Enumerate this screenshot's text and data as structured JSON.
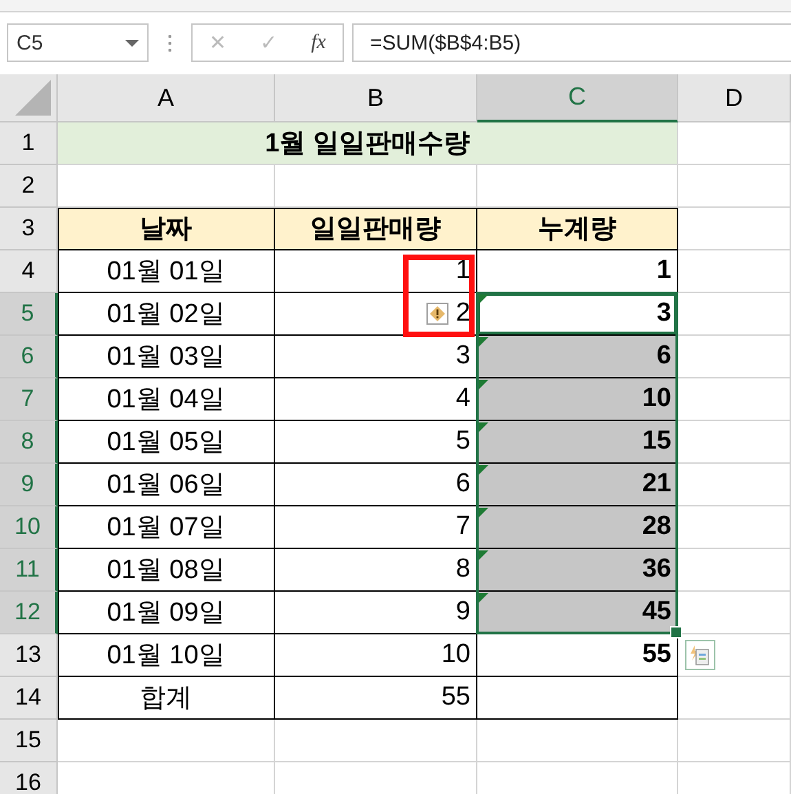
{
  "formula_bar": {
    "name_box": "C5",
    "cancel_button": {
      "label": "✕",
      "disabled": true
    },
    "enter_button": {
      "label": "✓",
      "disabled": true
    },
    "function_button": "fx",
    "formula": "=SUM($B$4:B5)"
  },
  "columns": [
    {
      "label": "A",
      "selected": false
    },
    {
      "label": "B",
      "selected": false
    },
    {
      "label": "C",
      "selected": true
    },
    {
      "label": "D",
      "selected": false
    }
  ],
  "rows": [
    {
      "num": "1",
      "selected": false,
      "cells": [
        {
          "kind": "title",
          "text": "1월 일일판매수량",
          "selected": false,
          "active": false,
          "flagged": false
        }
      ]
    },
    {
      "num": "2",
      "selected": false
    },
    {
      "num": "3",
      "selected": false,
      "cells": [
        {
          "kind": "header",
          "text": "날짜",
          "selected": false,
          "active": false,
          "flagged": false
        },
        {
          "kind": "header",
          "text": "일일판매량",
          "selected": false,
          "active": false,
          "flagged": false
        },
        {
          "kind": "header",
          "text": "누계량",
          "selected": false,
          "active": false,
          "flagged": false
        }
      ]
    },
    {
      "num": "4",
      "selected": false,
      "cells": [
        {
          "kind": "label",
          "text": "01월 01일",
          "selected": false,
          "active": false,
          "flagged": false
        },
        {
          "kind": "number",
          "text": "1",
          "selected": false,
          "active": false,
          "flagged": false
        },
        {
          "kind": "bold-number",
          "text": "1",
          "selected": false,
          "active": false,
          "flagged": false
        }
      ]
    },
    {
      "num": "5",
      "selected": true,
      "cells": [
        {
          "kind": "label",
          "text": "01월 02일",
          "selected": false,
          "active": false,
          "flagged": false
        },
        {
          "kind": "number",
          "text": "2",
          "selected": false,
          "active": false,
          "flagged": false,
          "badges": [
            {
              "kind": "error-check"
            }
          ]
        },
        {
          "kind": "bold-number",
          "text": "3",
          "selected": true,
          "active": true,
          "flagged": true
        }
      ]
    },
    {
      "num": "6",
      "selected": true,
      "cells": [
        {
          "kind": "label",
          "text": "01월 03일",
          "selected": false,
          "active": false,
          "flagged": false
        },
        {
          "kind": "number",
          "text": "3",
          "selected": false,
          "active": false,
          "flagged": false
        },
        {
          "kind": "bold-number",
          "text": "6",
          "selected": true,
          "active": false,
          "flagged": true
        }
      ]
    },
    {
      "num": "7",
      "selected": true,
      "cells": [
        {
          "kind": "label",
          "text": "01월 04일",
          "selected": false,
          "active": false,
          "flagged": false
        },
        {
          "kind": "number",
          "text": "4",
          "selected": false,
          "active": false,
          "flagged": false
        },
        {
          "kind": "bold-number",
          "text": "10",
          "selected": true,
          "active": false,
          "flagged": true
        }
      ]
    },
    {
      "num": "8",
      "selected": true,
      "cells": [
        {
          "kind": "label",
          "text": "01월 05일",
          "selected": false,
          "active": false,
          "flagged": false
        },
        {
          "kind": "number",
          "text": "5",
          "selected": false,
          "active": false,
          "flagged": false
        },
        {
          "kind": "bold-number",
          "text": "15",
          "selected": true,
          "active": false,
          "flagged": true
        }
      ]
    },
    {
      "num": "9",
      "selected": true,
      "cells": [
        {
          "kind": "label",
          "text": "01월 06일",
          "selected": false,
          "active": false,
          "flagged": false
        },
        {
          "kind": "number",
          "text": "6",
          "selected": false,
          "active": false,
          "flagged": false
        },
        {
          "kind": "bold-number",
          "text": "21",
          "selected": true,
          "active": false,
          "flagged": true
        }
      ]
    },
    {
      "num": "10",
      "selected": true,
      "cells": [
        {
          "kind": "label",
          "text": "01월 07일",
          "selected": false,
          "active": false,
          "flagged": false
        },
        {
          "kind": "number",
          "text": "7",
          "selected": false,
          "active": false,
          "flagged": false
        },
        {
          "kind": "bold-number",
          "text": "28",
          "selected": true,
          "active": false,
          "flagged": true
        }
      ]
    },
    {
      "num": "11",
      "selected": true,
      "cells": [
        {
          "kind": "label",
          "text": "01월 08일",
          "selected": false,
          "active": false,
          "flagged": false
        },
        {
          "kind": "number",
          "text": "8",
          "selected": false,
          "active": false,
          "flagged": false
        },
        {
          "kind": "bold-number",
          "text": "36",
          "selected": true,
          "active": false,
          "flagged": true
        }
      ]
    },
    {
      "num": "12",
      "selected": true,
      "cells": [
        {
          "kind": "label",
          "text": "01월 09일",
          "selected": false,
          "active": false,
          "flagged": false
        },
        {
          "kind": "number",
          "text": "9",
          "selected": false,
          "active": false,
          "flagged": false
        },
        {
          "kind": "bold-number",
          "text": "45",
          "selected": true,
          "active": false,
          "flagged": true
        }
      ]
    },
    {
      "num": "13",
      "selected": false,
      "cells": [
        {
          "kind": "label",
          "text": "01월 10일",
          "selected": false,
          "active": false,
          "flagged": false
        },
        {
          "kind": "number",
          "text": "10",
          "selected": false,
          "active": false,
          "flagged": false
        },
        {
          "kind": "bold-number",
          "text": "55",
          "selected": false,
          "active": false,
          "flagged": false,
          "badges": [
            {
              "kind": "quick-analysis"
            }
          ]
        }
      ]
    },
    {
      "num": "14",
      "selected": false,
      "cells": [
        {
          "kind": "label",
          "text": "합계",
          "selected": false,
          "active": false,
          "flagged": false
        },
        {
          "kind": "number",
          "text": "55",
          "selected": false,
          "active": false,
          "flagged": false
        },
        {
          "kind": "empty",
          "selected": false,
          "active": false,
          "flagged": false
        }
      ]
    },
    {
      "num": "15",
      "selected": false
    },
    {
      "num": "16",
      "selected": false
    }
  ],
  "markup": [
    {
      "kind": "rectangle"
    }
  ]
}
